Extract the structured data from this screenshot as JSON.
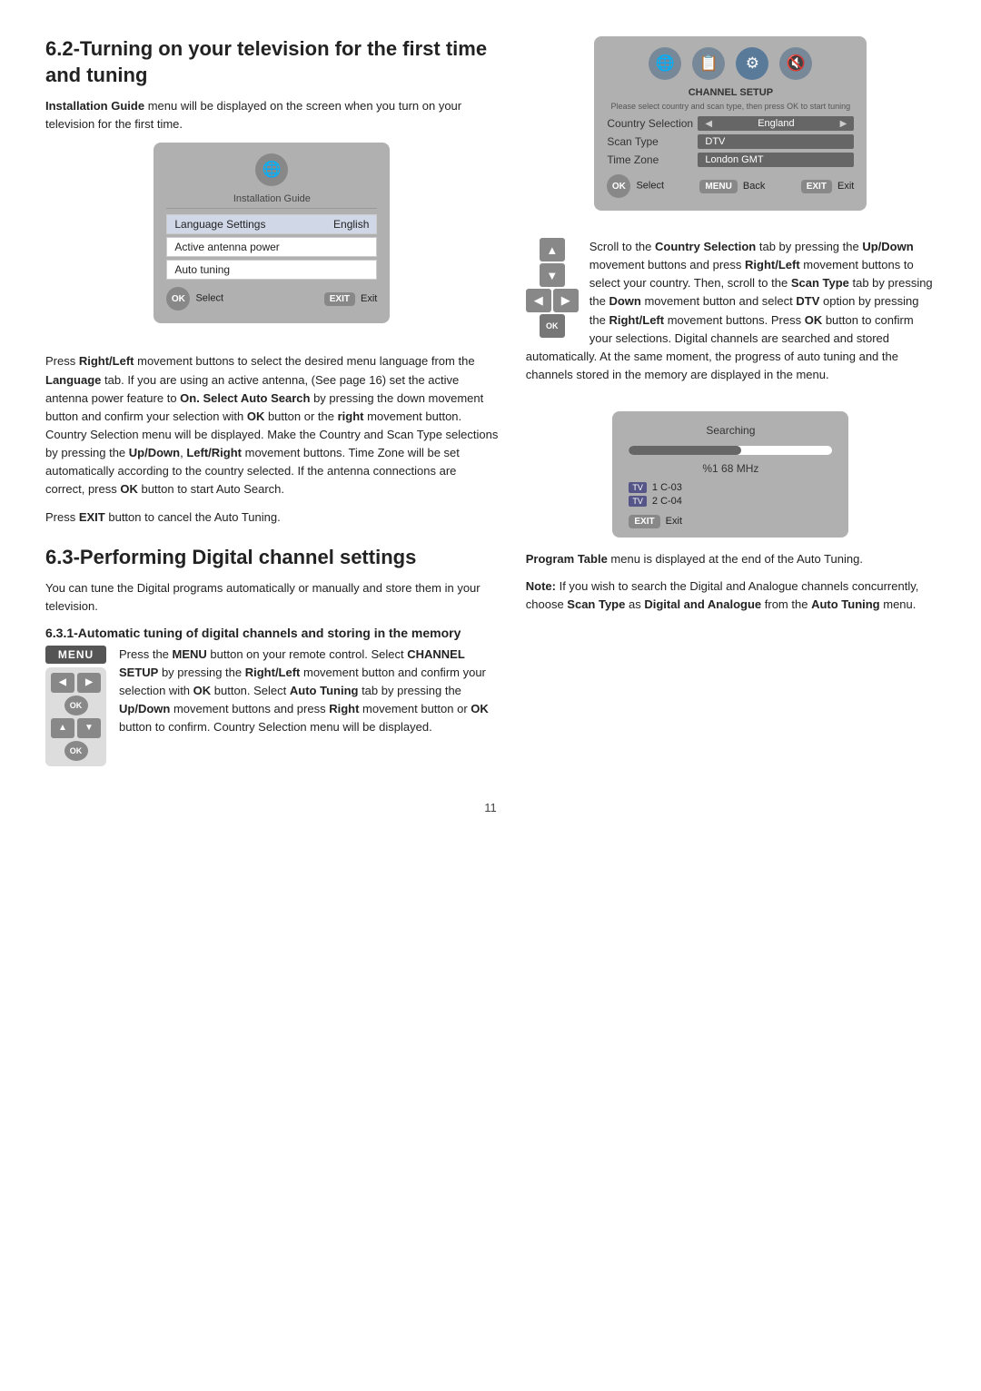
{
  "page": {
    "number": "11"
  },
  "section_6_2": {
    "title": "6.2-Turning on your television for the first time and tuning",
    "intro_bold": "Installation Guide",
    "intro_text": " menu will be displayed on the screen when you turn on your television for the first time.",
    "tv_menu": {
      "title": "Installation Guide",
      "rows": [
        {
          "label": "Language Settings",
          "value": "English"
        },
        {
          "label": "Active antenna power",
          "value": ""
        },
        {
          "label": "Auto tuning",
          "value": ""
        }
      ],
      "footer_ok": "OK",
      "footer_select": "Select",
      "footer_exit_label": "EXIT",
      "footer_exit": "Exit"
    },
    "body_paragraphs": [
      "Press Right/Left movement buttons to select the desired menu language from the Language tab. If you are using an active antenna, (See page 16) set the active antenna power feature to On. Select Auto Search by pressing the down movement button and confirm your selection with OK button or the right movement button. Country Selection menu will be displayed. Make the Country and Scan Type selections by pressing the Up/Down, Left/Right movement buttons. Time Zone will be set automatically according to the country selected. If the antenna connections are correct, press OK button to start Auto Search.",
      "Press EXIT button to cancel the Auto Tuning."
    ],
    "channel_setup": {
      "title": "CHANNEL SETUP",
      "subtitle": "Please select country and scan type, then press OK to start tuning",
      "rows": [
        {
          "label": "Country Selection",
          "value": "England",
          "has_arrows": true
        },
        {
          "label": "Scan Type",
          "value": "DTV",
          "has_arrows": false
        },
        {
          "label": "Time Zone",
          "value": "London GMT",
          "has_arrows": false
        }
      ],
      "footer_ok": "OK",
      "footer_select": "Select",
      "footer_menu": "MENU",
      "footer_back": "Back",
      "footer_exit_label": "EXIT",
      "footer_exit": "Exit"
    },
    "right_text_p1_start": "Scroll to the ",
    "right_text_p1_bold1": "Country Selection",
    "right_text_p1_mid1": " tab by pressing the ",
    "right_text_p1_bold2": "Up/Down",
    "right_text_p1_mid2": " movement buttons and press ",
    "right_text_p1_bold3": "Right/Left",
    "right_text_p1_mid3": " movement buttons to select your country. Then, scroll to the ",
    "right_text_p1_bold4": "Scan Type",
    "right_text_p1_mid4": " tab by pressing the ",
    "right_text_p1_bold5": "Down",
    "right_text_p1_mid5": " movement button and select ",
    "right_text_p1_bold6": "DTV",
    "right_text_p1_end": " option by pressing the Right/Left movement buttons. Press OK button to confirm your selections. Digital channels are searched and stored automatically. At the same moment, the progress of auto tuning and the channels stored in the memory are displayed in the menu."
  },
  "section_6_3": {
    "title": "6.3-Performing Digital channel settings",
    "intro": "You can tune the Digital programs automatically or manually and store them in your television.",
    "sub_6_3_1": {
      "title": "6.3.1-Automatic tuning of digital channels and storing in the memory",
      "body_p1_start": "Press the ",
      "body_p1_bold1": "MENU",
      "body_p1_mid1": " button on your remote control. Select ",
      "body_p1_bold2": "CHANNEL SETUP",
      "body_p1_mid2": " by pressing the ",
      "body_p1_bold3": "Right/Left",
      "body_p1_mid3": " movement button and confirm your selection with ",
      "body_p1_bold4": "OK",
      "body_p1_mid4": " button. Select ",
      "body_p1_bold5": "Auto Tuning",
      "body_p1_mid5": " tab by pressing the ",
      "body_p1_bold6": "Up/Down",
      "body_p1_mid6": " movement buttons and press ",
      "body_p1_bold7": "Right",
      "body_p1_mid7": " movement button or ",
      "body_p1_bold8": "OK",
      "body_p1_end": " button to confirm. Country Selection menu will be displayed."
    },
    "searching_box": {
      "title": "Searching",
      "freq": "%1 68 MHz",
      "channels": [
        {
          "tag": "TV",
          "name": "1 C-03"
        },
        {
          "tag": "TV",
          "name": "2 C-04"
        }
      ],
      "footer_exit_label": "EXIT",
      "footer_exit": "Exit"
    },
    "bottom_p1_bold": "Program Table",
    "bottom_p1": " menu is displayed at the end of the Auto Tuning.",
    "bottom_p2_start": "Note:",
    "bottom_p2_mid": " If you wish to search the Digital and Analogue channels concurrently, choose ",
    "bottom_p2_bold1": "Scan Type",
    "bottom_p2_mid2": " as ",
    "bottom_p2_bold2": "Digital and Analogue",
    "bottom_p2_end": " from the ",
    "bottom_p2_bold3": "Auto Tuning",
    "bottom_p2_final": " menu."
  }
}
